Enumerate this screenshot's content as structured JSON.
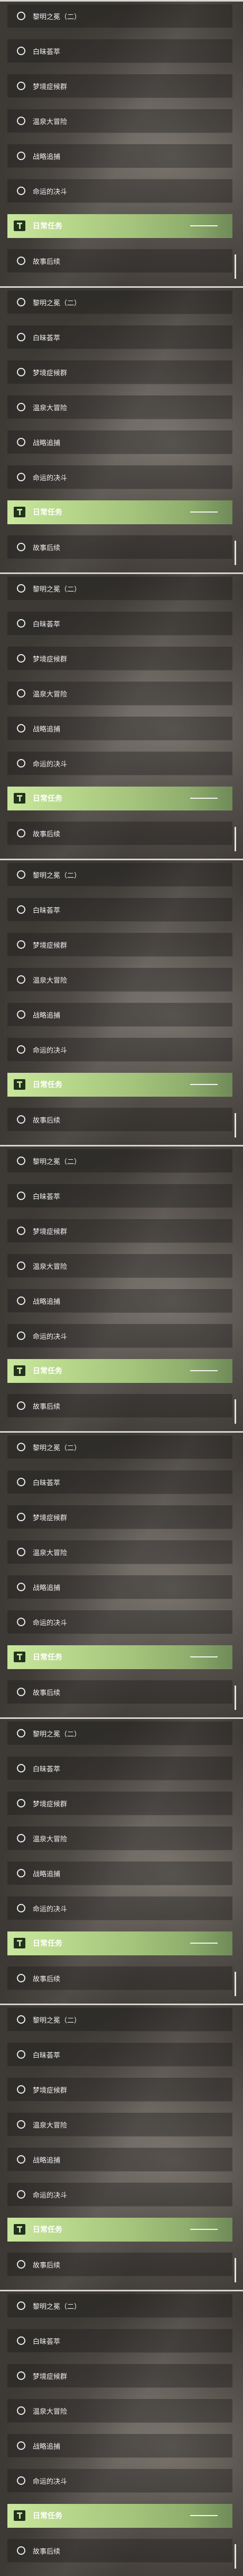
{
  "panels": [
    {
      "items": [
        "黎明之冕（二）",
        "白昧荟萃",
        "梦境症候群",
        "温泉大冒险",
        "战略追捕",
        "命运的决斗"
      ],
      "highlight": "日常任务",
      "last": "故事后续"
    },
    {
      "items": [
        "黎明之冕（二）",
        "白昧荟萃",
        "梦境症候群",
        "温泉大冒险",
        "战略追捕",
        "命运的决斗"
      ],
      "highlight": "日常任务",
      "last": "故事后续"
    },
    {
      "items": [
        "黎明之冕（二）",
        "白昧荟萃",
        "梦境症候群",
        "温泉大冒险",
        "战略追捕",
        "命运的决斗"
      ],
      "highlight": "日常任务",
      "last": "故事后续"
    },
    {
      "items": [
        "黎明之冕（二）",
        "白昧荟萃",
        "梦境症候群",
        "温泉大冒险",
        "战略追捕",
        "命运的决斗"
      ],
      "highlight": "日常任务",
      "last": "故事后续"
    },
    {
      "items": [
        "黎明之冕（二）",
        "白昧荟萃",
        "梦境症候群",
        "温泉大冒险",
        "战略追捕",
        "命运的决斗"
      ],
      "highlight": "日常任务",
      "last": "故事后续"
    },
    {
      "items": [
        "黎明之冕（二）",
        "白昧荟萃",
        "梦境症候群",
        "温泉大冒险",
        "战略追捕",
        "命运的决斗"
      ],
      "highlight": "日常任务",
      "last": "故事后续"
    },
    {
      "items": [
        "黎明之冕（二）",
        "白昧荟萃",
        "梦境症候群",
        "温泉大冒险",
        "战略追捕",
        "命运的决斗"
      ],
      "highlight": "日常任务",
      "last": "故事后续"
    },
    {
      "items": [
        "黎明之冕（二）",
        "白昧荟萃",
        "梦境症候群",
        "温泉大冒险",
        "战略追捕",
        "命运的决斗"
      ],
      "highlight": "日常任务",
      "last": "故事后续"
    },
    {
      "items": [
        "黎明之冕（二）",
        "白昧荟萃",
        "梦境症候群",
        "温泉大冒险",
        "战略追捕",
        "命运的决斗"
      ],
      "highlight": "日常任务",
      "last": "故事后续"
    }
  ],
  "colors": {
    "highlight_start": "#c9e79d",
    "highlight_end": "#6f8a58",
    "background": "#3a3633"
  },
  "icons": {
    "ring": "circle-outline-icon",
    "task": "daily-task-icon"
  }
}
